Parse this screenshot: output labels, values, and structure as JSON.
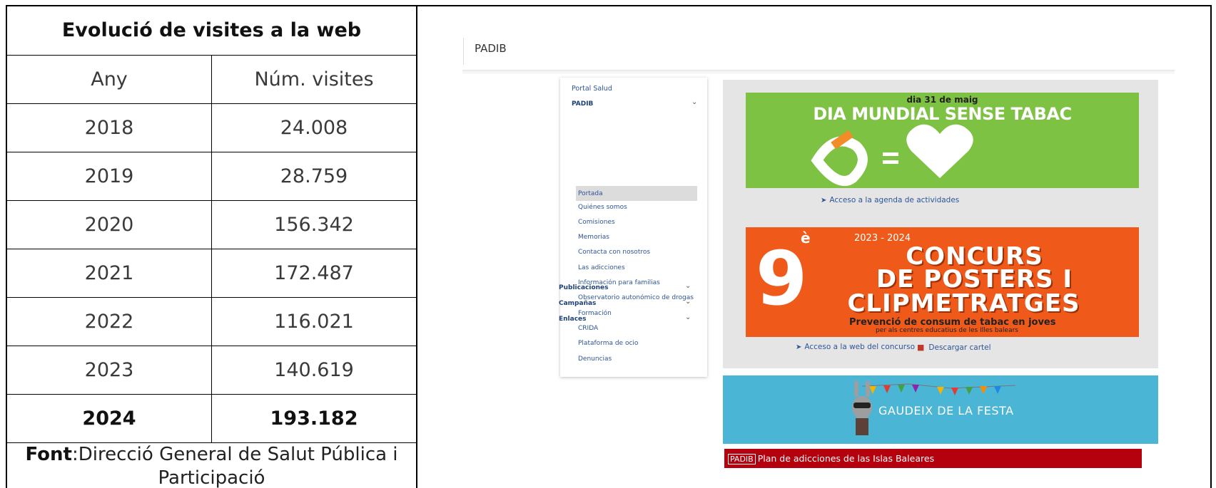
{
  "table": {
    "title": "Evolució de visites a la web",
    "headers": [
      "Any",
      "Núm. visites"
    ],
    "rows": [
      [
        "2018",
        "24.008"
      ],
      [
        "2019",
        "28.759"
      ],
      [
        "2020",
        "156.342"
      ],
      [
        "2021",
        "172.487"
      ],
      [
        "2022",
        "116.021"
      ],
      [
        "2023",
        "140.619"
      ],
      [
        "2024",
        "193.182"
      ]
    ],
    "source_label": "Font",
    "source_text": ":Direcció General de Salut Pública i Participació"
  },
  "web": {
    "header": "PADIB",
    "sidebar": {
      "top": "Portal Salud",
      "section": "PADIB",
      "items": [
        "Portada",
        "Quiénes somos",
        "Comisiones",
        "Memorias",
        "Contacta con nosotros",
        "Las adicciones",
        "Información para familias",
        "Observatorio autonómico de drogas",
        "Formación",
        "CRIDA",
        "Plataforma de ocio",
        "Denuncias"
      ],
      "sections": [
        "Publicaciones",
        "Campañas",
        "Enlaces"
      ]
    },
    "banner1": {
      "date": "dia 31 de maig",
      "title": "DIA MUNDIAL SENSE TABAC"
    },
    "link1": "Acceso a la agenda de actividades",
    "banner2": {
      "number": "9",
      "sup": "è",
      "years": "2023 - 2024",
      "line1": "CONCURS",
      "line2": "DE POSTERS I",
      "line3": "CLIPMETRATGES",
      "sub1": "Prevenció de consum de tabac en joves",
      "sub2": "per als centres educatius de les Illes balears"
    },
    "link2": "Acceso a la web del concurso",
    "link3": "Descargar cartel",
    "banner3": {
      "text": "GAUDEIX DE LA FESTA"
    },
    "footer": {
      "tag": "PADIB",
      "text": "Plan de adicciones de las Islas Baleares"
    }
  }
}
